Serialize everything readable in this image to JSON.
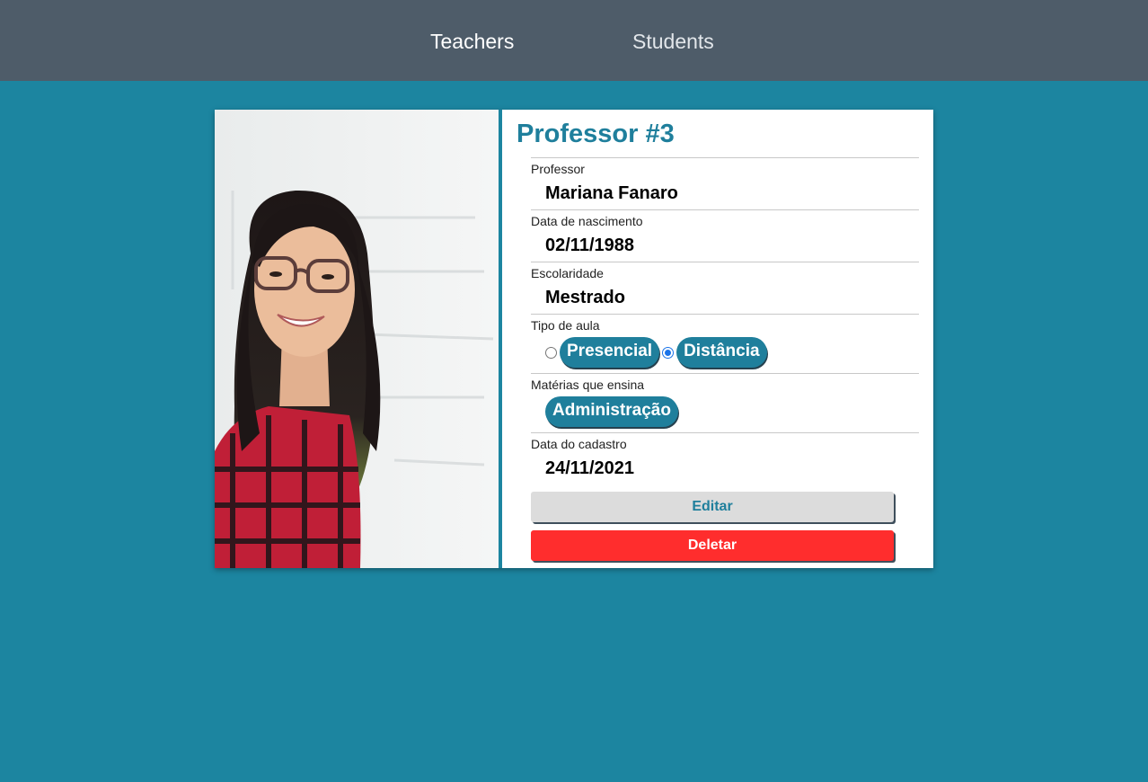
{
  "nav": {
    "teachers_label": "Teachers",
    "students_label": "Students"
  },
  "card": {
    "title": "Professor #3",
    "fields": {
      "professor": {
        "label": "Professor",
        "value": "Mariana Fanaro"
      },
      "birth_date": {
        "label": "Data de nascimento",
        "value": "02/11/1988"
      },
      "education": {
        "label": "Escolaridade",
        "value": "Mestrado"
      },
      "class_type": {
        "label": "Tipo de aula",
        "options": [
          "Presencial",
          "Distância"
        ],
        "selected": "Distância"
      },
      "subjects": {
        "label": "Matérias que ensina",
        "items": [
          "Administração"
        ]
      },
      "registration_date": {
        "label": "Data do cadastro",
        "value": "24/11/2021"
      }
    },
    "edit_label": "Editar",
    "delete_label": "Deletar"
  },
  "colors": {
    "background": "#1c85a0",
    "navbar": "#4e5c69",
    "accent": "#1f7f9c",
    "delete": "#ff2d2d",
    "edit_bg": "#dcdcdc"
  }
}
